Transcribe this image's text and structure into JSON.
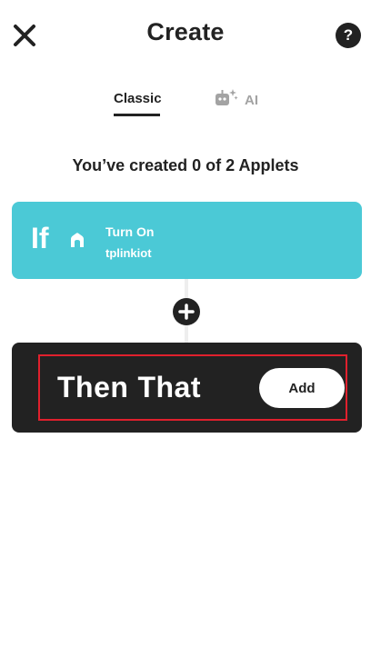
{
  "header": {
    "title": "Create",
    "close_icon": "close-icon",
    "help_label": "?"
  },
  "tabs": [
    {
      "label": "Classic",
      "active": true
    },
    {
      "label": "AI",
      "active": false,
      "icon": "robot-sparkle-icon"
    }
  ],
  "status": {
    "applet_count_text": "You’ve created 0 of 2 Applets"
  },
  "if_card": {
    "label": "If",
    "service_icon": "home-icon",
    "trigger_name": "Turn On",
    "service_name": "tplinkiot",
    "color": "#4bc9d6"
  },
  "add_step": {
    "icon": "plus-icon"
  },
  "then_card": {
    "label_then": "Then",
    "label_that": "That",
    "add_label": "Add",
    "color": "#222222",
    "highlight_color": "#e0202d"
  }
}
